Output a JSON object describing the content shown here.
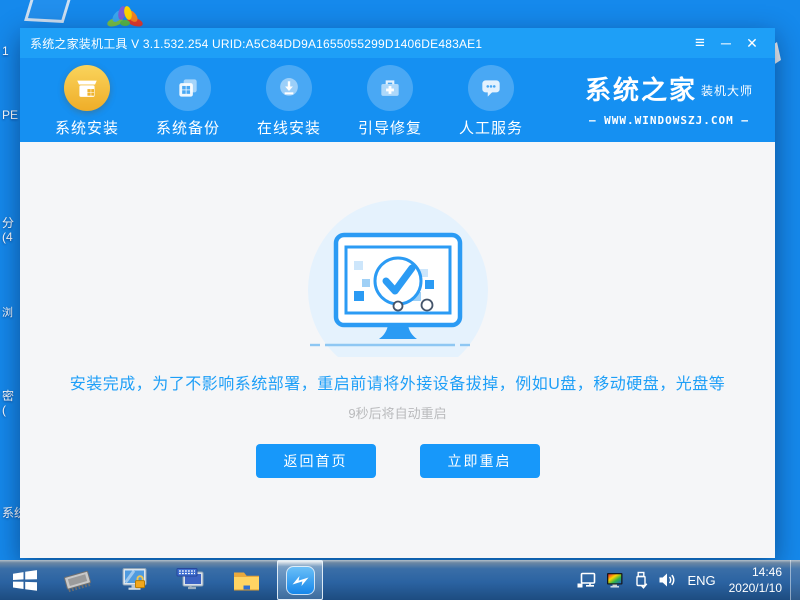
{
  "desktop": {
    "fragments": [
      {
        "text": "1"
      },
      {
        "text": "PE"
      },
      {
        "text": "分"
      },
      {
        "text": "(4"
      },
      {
        "text": "浏"
      },
      {
        "text": "密"
      },
      {
        "text": "("
      },
      {
        "text": "系统"
      }
    ]
  },
  "window": {
    "title": "系统之家装机工具 V 3.1.532.254 URID:A5C84DD9A1655055299D1406DE483AE1",
    "controls": {
      "menu": "≡",
      "minimize": "─",
      "close": "✕"
    },
    "nav": {
      "items": [
        {
          "label": "系统安装",
          "icon": "install-box-icon",
          "active": true
        },
        {
          "label": "系统备份",
          "icon": "backup-copies-icon",
          "active": false
        },
        {
          "label": "在线安装",
          "icon": "online-download-icon",
          "active": false
        },
        {
          "label": "引导修复",
          "icon": "boot-repair-toolbox-icon",
          "active": false
        },
        {
          "label": "人工服务",
          "icon": "support-chat-icon",
          "active": false
        }
      ]
    },
    "logo": {
      "title": "系统之家",
      "subtitle": "装机大师",
      "site_line": "—  WWW.WINDOWSZJ.COM  —"
    },
    "main": {
      "message": "安装完成，为了不影响系统部署，重启前请将外接设备拔掉，例如U盘，移动硬盘，光盘等",
      "countdown": "9秒后将自动重启",
      "buttons": [
        {
          "label": "返回首页"
        },
        {
          "label": "立即重启"
        }
      ]
    }
  },
  "taskbar": {
    "apps": [
      {
        "name": "start-button"
      },
      {
        "name": "memory-chip-app"
      },
      {
        "name": "screen-lock-app"
      },
      {
        "name": "onscreen-keyboard-app"
      },
      {
        "name": "file-explorer-app"
      },
      {
        "name": "zhuangji-installer-app",
        "active": true
      }
    ],
    "tray": {
      "language": "ENG",
      "time": "14:46",
      "date": "2020/1/10"
    }
  },
  "colors": {
    "desktop_bg": "#1589ec",
    "titlebar_bg": "#1e9ff7",
    "navbar_bg": "#1590f2",
    "active_circle_gold": "#f2bb3f",
    "inactive_circle_blue": "#49a8f4",
    "content_bg": "#f5f6f8",
    "accent_blue": "#1798fa",
    "message_blue": "#1e9ff7",
    "countdown_gray": "#b9babc",
    "taskbar_blue": "#2b63a2"
  }
}
